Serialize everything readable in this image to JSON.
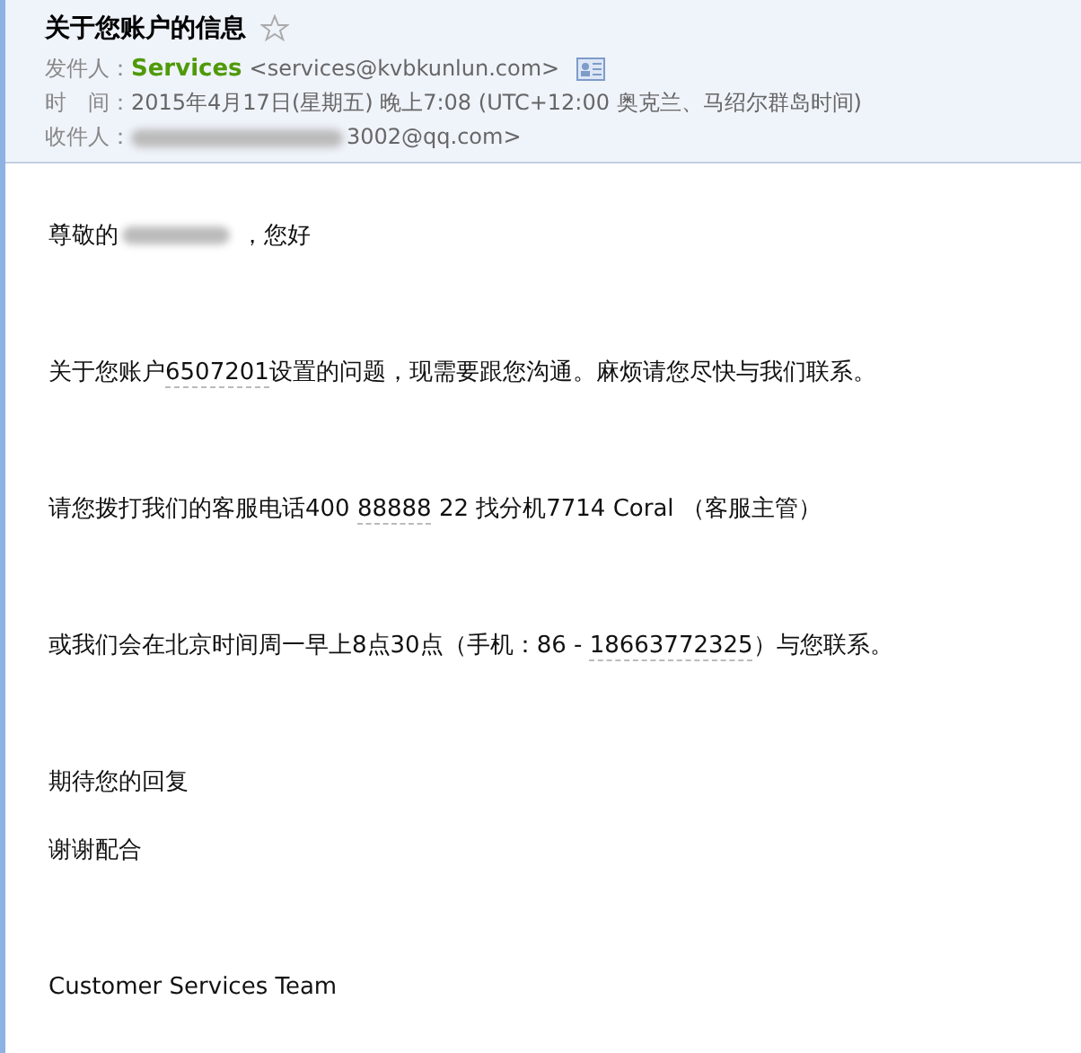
{
  "header": {
    "subject": "关于您账户的信息",
    "starred": false,
    "from": {
      "label": "发件人：",
      "name": "Services",
      "address": "<services@kvbkunlun.com>"
    },
    "time": {
      "label": "时　间：",
      "value": "2015年4月17日(星期五) 晚上7:08 (UTC+12:00 奥克兰、马绍尔群岛时间)"
    },
    "to": {
      "label": "收件人：",
      "address": "3002@qq.com>"
    }
  },
  "body": [
    {
      "parts": [
        {
          "text": "尊敬的",
          "underlined": false
        },
        {
          "kind": "redacted"
        },
        {
          "text": "，您好",
          "underlined": false
        }
      ]
    },
    {
      "parts": [
        {
          "text": "关于您账户",
          "underlined": false
        },
        {
          "text": "6507201",
          "underlined": true
        },
        {
          "text": "设置的问题，现需要跟您沟通。麻烦请您尽快与我们联系。",
          "underlined": false
        }
      ]
    },
    {
      "parts": [
        {
          "text": "请您拨打我们的客服电话400 ",
          "underlined": false
        },
        {
          "text": "88888",
          "underlined": true
        },
        {
          "text": " 22  找分机7714 Coral （客服主管）",
          "underlined": false
        }
      ]
    },
    {
      "parts": [
        {
          "text": "或我们会在北京时间周一早上8点30点（手机：86 - ",
          "underlined": false
        },
        {
          "text": "18663772325",
          "underlined": true
        },
        {
          "text": "）与您联系。",
          "underlined": false
        }
      ]
    },
    {
      "parts": [
        {
          "text": "期待您的回复",
          "underlined": false
        }
      ]
    },
    {
      "parts": [
        {
          "text": "谢谢配合",
          "underlined": false
        }
      ]
    },
    {
      "parts": [
        {
          "text": "Customer Services Team",
          "underlined": false
        }
      ]
    }
  ]
}
